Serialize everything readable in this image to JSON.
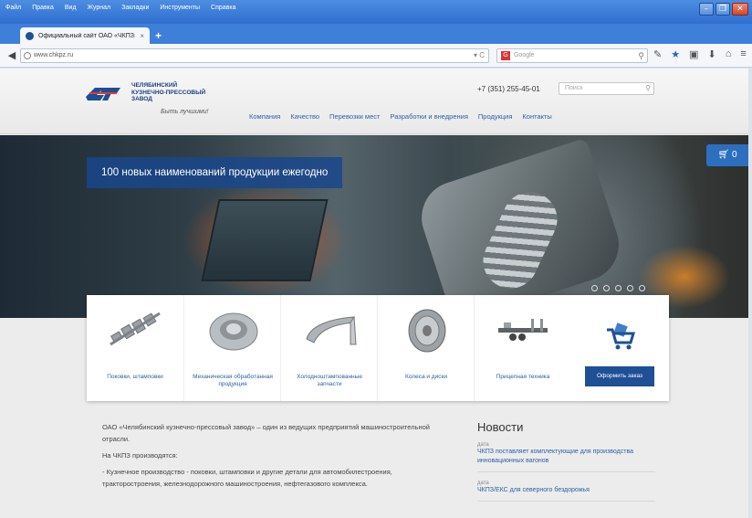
{
  "browser": {
    "menu": [
      "Файл",
      "Правка",
      "Вид",
      "Журнал",
      "Закладки",
      "Инструменты",
      "Справка"
    ],
    "tab_title": "Официальный сайт ОАО «ЧКПЗ»",
    "tab_close": "×",
    "new_tab": "+",
    "url": "www.chkpz.ru",
    "url_tail": "▾ C",
    "search_engine": "G",
    "search_placeholder": "Google",
    "window_buttons": [
      "–",
      "❐",
      "✕"
    ],
    "toolbar_icons": [
      "pencil-icon",
      "star-icon",
      "bookmarks-icon",
      "download-icon",
      "home-icon",
      "menu-icon"
    ]
  },
  "site": {
    "logo_text": [
      "ЧЕЛЯБИНСКИЙ",
      "КУЗНЕЧНО-ПРЕССОВЫЙ",
      "ЗАВОД"
    ],
    "slogan": "Быть лучшими!",
    "phone": "+7 (351) 255-45-01",
    "search_placeholder": "Поиск",
    "nav": [
      "Компания",
      "Качество",
      "Перевозки мест",
      "Разработки и внедрения",
      "Продукция",
      "Контакты"
    ],
    "hero_banner": "100 новых наименований продукции ежегодно",
    "cart_label": "0",
    "products": [
      {
        "label": "Поковки, штамповки"
      },
      {
        "label": "Механическая обработанная продукция"
      },
      {
        "label": "Холодноштампованные запчасти"
      },
      {
        "label": "Колеса и диски"
      },
      {
        "label": "Прицепная техника"
      }
    ],
    "order_label": "Оформить заказ",
    "intro": [
      "ОАО «Челябинский кузнечно-прессовый завод» – один из ведущих предприятий машиностроительной отрасли.",
      "На ЧКПЗ производятся:",
      "- Кузнечное производство - поковки, штамповки и другие детали для автомобилестроения, тракторостроения, железнодорожного машиностроения, нефтегазового комплекса."
    ],
    "news_title": "Новости",
    "news": [
      {
        "date": "дата",
        "text": "ЧКПЗ поставляет комплектующие для производства инновационных вагонов"
      },
      {
        "date": "дата",
        "text": "ЧКПЗ/ЕКС для северного бездорожья"
      }
    ]
  },
  "colors": {
    "titlebar": "#2f6ecf",
    "brand_blue": "#1f4f95",
    "link_blue": "#2c5fa3"
  }
}
